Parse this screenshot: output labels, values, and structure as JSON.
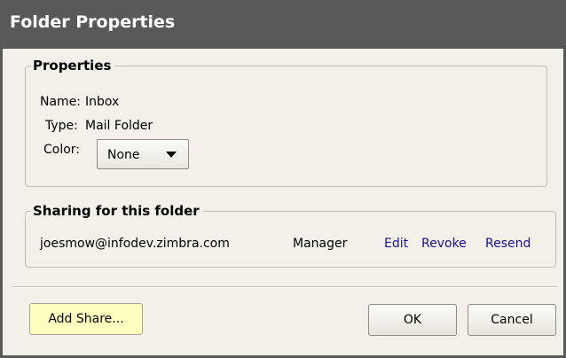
{
  "window": {
    "title": "Folder Properties"
  },
  "properties": {
    "legend": "Properties",
    "name_label": "Name:",
    "name_value": "Inbox",
    "type_label": "Type:",
    "type_value": "Mail Folder",
    "color_label": "Color:",
    "color_value": "None"
  },
  "sharing": {
    "legend": "Sharing for this folder",
    "shares": [
      {
        "email": "joesmow@infodev.zimbra.com",
        "role": "Manager",
        "actions": [
          "Edit",
          "Revoke",
          "Resend"
        ]
      }
    ]
  },
  "footer": {
    "add_share_label": "Add Share...",
    "ok_label": "OK",
    "cancel_label": "Cancel"
  },
  "colors": {
    "titlebar": "#595a58",
    "dialog_bg": "#f2f0e8",
    "link": "#1c0f9c",
    "add_share_bg": "#ffffbf"
  }
}
